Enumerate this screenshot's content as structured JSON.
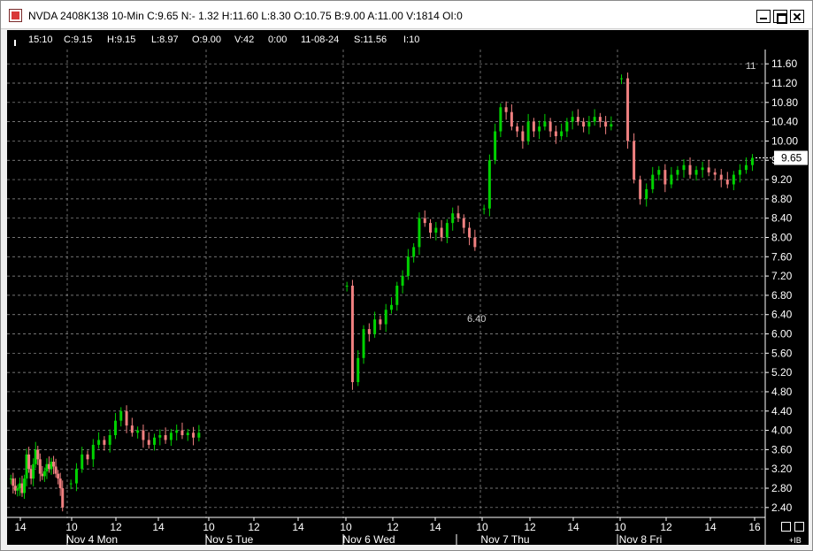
{
  "window": {
    "title": "NVDA 2408K138 10-Min C:9.65 N:- 1.32 H:11.60 L:8.30 O:10.75 B:9.00 A:11.00 V:1814 OI:0"
  },
  "info_bar": {
    "time": "15:10",
    "close": "C:9.15",
    "high": "H:9.15",
    "low": "L:8.97",
    "open": "O:9.00",
    "volume": "V:42",
    "zero": "0:00",
    "date": "11-08-24",
    "strike": "S:11.56",
    "interval": "I:10"
  },
  "chart_data": {
    "type": "candlestick",
    "symbol": "NVDA 2408K138",
    "interval": "10-Min",
    "ylim": [
      2.25,
      11.75
    ],
    "y_ticks": [
      "11.60",
      "11.20",
      "10.80",
      "10.40",
      "10.00",
      "9.60",
      "9.20",
      "8.80",
      "8.40",
      "8.00",
      "7.60",
      "7.20",
      "6.80",
      "6.40",
      "6.00",
      "5.60",
      "5.20",
      "4.80",
      "4.40",
      "4.00",
      "3.60",
      "3.20",
      "2.80",
      "2.40"
    ],
    "current_price_label": "9.65",
    "annotations": [
      "11",
      "6.40"
    ],
    "x_tick_labels": [
      "14",
      "10",
      "12",
      "14",
      "10",
      "12",
      "14",
      "10",
      "12",
      "14",
      "10",
      "12",
      "14",
      "10",
      "12",
      "14",
      "16"
    ],
    "day_labels": [
      "Nov 4 Mon",
      "Nov 5 Tue",
      "Nov 6 Wed",
      "Nov 7 Thu",
      "Nov 8 Fri"
    ],
    "colors": {
      "up": "#00d200",
      "down": "#f08080",
      "grid": "#9a9a9a",
      "text": "#ffffff"
    },
    "days": [
      {
        "label": "Nov 4 Mon",
        "path": [
          3.0,
          2.85,
          2.75,
          2.8,
          2.9,
          2.7,
          3.0,
          3.5,
          3.2,
          3.0,
          3.3,
          3.6,
          3.4,
          3.1,
          3.05,
          3.15,
          3.3,
          3.2,
          3.35,
          3.25,
          3.1,
          3.0,
          2.8,
          2.4
        ]
      },
      {
        "label": "Nov 5 Tue",
        "path": [
          2.9,
          3.2,
          3.5,
          3.4,
          3.7,
          3.8,
          3.7,
          3.9,
          4.2,
          4.4,
          4.1,
          3.95,
          4.0,
          3.8,
          3.7,
          3.85,
          3.9,
          3.8,
          3.95,
          4.0,
          3.9,
          3.95,
          3.85,
          3.95
        ]
      },
      {
        "label": "Nov 6 Wed",
        "path": [
          7.0,
          5.0,
          5.5,
          6.1,
          6.0,
          6.3,
          6.2,
          6.5,
          6.6,
          7.0,
          7.2,
          7.6,
          7.8,
          8.4,
          8.3,
          8.1,
          8.2,
          8.0,
          8.3,
          8.5,
          8.4,
          8.2,
          8.0,
          7.8
        ]
      },
      {
        "label": "Nov 7 Thu",
        "path": [
          8.6,
          9.6,
          10.2,
          10.7,
          10.6,
          10.3,
          10.2,
          10.0,
          10.4,
          10.2,
          10.3,
          10.4,
          10.2,
          10.1,
          10.2,
          10.4,
          10.5,
          10.4,
          10.3,
          10.4,
          10.5,
          10.4,
          10.3,
          10.35
        ]
      },
      {
        "label": "Nov 8 Fri",
        "path": [
          11.3,
          10.0,
          9.2,
          8.8,
          9.0,
          9.3,
          9.4,
          9.1,
          9.3,
          9.4,
          9.5,
          9.3,
          9.4,
          9.45,
          9.35,
          9.3,
          9.2,
          9.1,
          9.3,
          9.4,
          9.5,
          9.65
        ]
      }
    ]
  }
}
